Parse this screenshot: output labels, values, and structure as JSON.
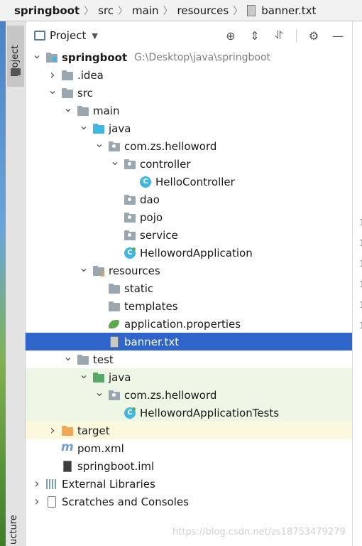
{
  "breadcrumb": [
    "springboot",
    "src",
    "main",
    "resources",
    "banner.txt"
  ],
  "sidebar": {
    "project_tab": "Project",
    "structure_tab": "ucture"
  },
  "panel": {
    "title": "Project",
    "tools": [
      "locate-icon",
      "expand-all-icon",
      "collapse-all-icon",
      "gear-icon",
      "hide-icon"
    ]
  },
  "tree": [
    {
      "label": "springboot",
      "path": "G:\\Desktop\\java\\springboot",
      "bold": true,
      "depth": 0,
      "arrow": "open",
      "icon": "module-folder-icon"
    },
    {
      "label": ".idea",
      "depth": 1,
      "arrow": "closed",
      "icon": "folder-icon"
    },
    {
      "label": "src",
      "depth": 1,
      "arrow": "open",
      "icon": "folder-icon"
    },
    {
      "label": "main",
      "depth": 2,
      "arrow": "open",
      "icon": "folder-icon"
    },
    {
      "label": "java",
      "depth": 3,
      "arrow": "open",
      "icon": "source-folder-icon"
    },
    {
      "label": "com.zs.helloword",
      "depth": 4,
      "arrow": "open",
      "icon": "package-icon"
    },
    {
      "label": "controller",
      "depth": 5,
      "arrow": "open",
      "icon": "package-icon"
    },
    {
      "label": "HelloController",
      "depth": 6,
      "arrow": "",
      "icon": "class-icon"
    },
    {
      "label": "dao",
      "depth": 5,
      "arrow": "",
      "icon": "package-icon"
    },
    {
      "label": "pojo",
      "depth": 5,
      "arrow": "",
      "icon": "package-icon"
    },
    {
      "label": "service",
      "depth": 5,
      "arrow": "",
      "icon": "package-icon"
    },
    {
      "label": "HellowordApplication",
      "depth": 5,
      "arrow": "",
      "icon": "spring-class-icon"
    },
    {
      "label": "resources",
      "depth": 3,
      "arrow": "open",
      "icon": "resources-folder-icon"
    },
    {
      "label": "static",
      "depth": 4,
      "arrow": "",
      "icon": "folder-icon"
    },
    {
      "label": "templates",
      "depth": 4,
      "arrow": "",
      "icon": "folder-icon"
    },
    {
      "label": "application.properties",
      "depth": 4,
      "arrow": "",
      "icon": "spring-properties-icon"
    },
    {
      "label": "banner.txt",
      "depth": 4,
      "arrow": "",
      "icon": "text-file-icon",
      "selected": true
    },
    {
      "label": "test",
      "depth": 2,
      "arrow": "open",
      "icon": "folder-icon"
    },
    {
      "label": "java",
      "depth": 3,
      "arrow": "open",
      "icon": "test-folder-icon",
      "test": true
    },
    {
      "label": "com.zs.helloword",
      "depth": 4,
      "arrow": "open",
      "icon": "package-icon",
      "test": true
    },
    {
      "label": "HellowordApplicationTests",
      "depth": 5,
      "arrow": "",
      "icon": "spring-class-icon",
      "test": true
    },
    {
      "label": "target",
      "depth": 1,
      "arrow": "closed",
      "icon": "excluded-folder-icon",
      "target": true
    },
    {
      "label": "pom.xml",
      "depth": 1,
      "arrow": "",
      "icon": "maven-icon"
    },
    {
      "label": "springboot.iml",
      "depth": 1,
      "arrow": "",
      "icon": "iml-file-icon"
    },
    {
      "label": "External Libraries",
      "depth": 0,
      "arrow": "closed",
      "icon": "libraries-icon"
    },
    {
      "label": "Scratches and Consoles",
      "depth": 0,
      "arrow": "closed",
      "icon": "scratches-icon"
    }
  ],
  "gutter": [
    "1",
    "1",
    "1",
    "1",
    "1",
    "1"
  ],
  "watermark": "https://blog.csdn.net/zs18753479279"
}
